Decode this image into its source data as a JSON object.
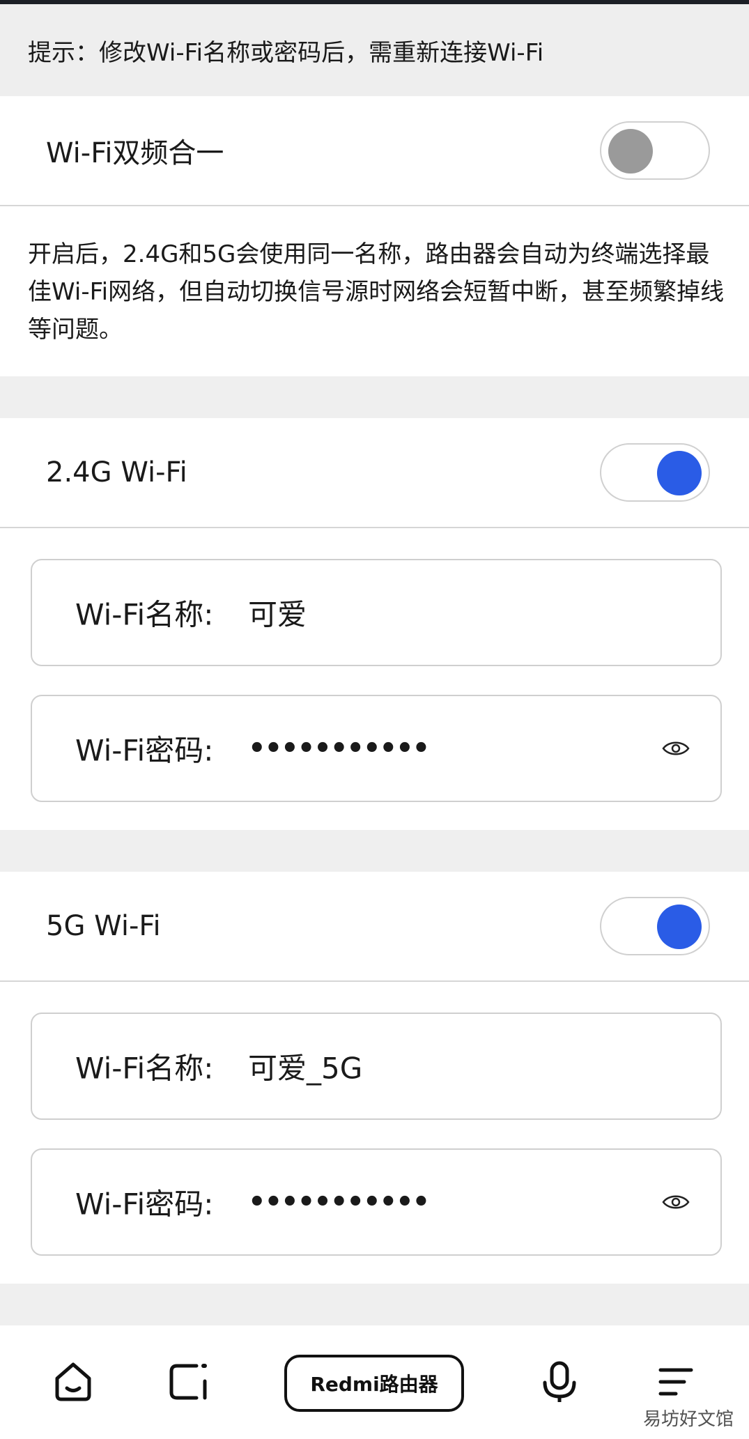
{
  "notice": "提示：修改Wi-Fi名称或密码后，需重新连接Wi-Fi",
  "dual_band": {
    "label": "Wi-Fi双频合一",
    "enabled": false,
    "description": "开启后，2.4G和5G会使用同一名称，路由器会自动为终端选择最佳Wi-Fi网络，但自动切换信号源时网络会短暂中断，甚至频繁掉线等问题。"
  },
  "band_24": {
    "label": "2.4G Wi-Fi",
    "enabled": true,
    "name_label": "Wi-Fi名称:",
    "name_value": "可爱",
    "password_label": "Wi-Fi密码:",
    "password_value": "•••••••••••",
    "show_password_icon": "eye-icon"
  },
  "band_5": {
    "label": "5G Wi-Fi",
    "enabled": true,
    "name_label": "Wi-Fi名称:",
    "name_value": "可爱_5G",
    "password_label": "Wi-Fi密码:",
    "password_value": "•••••••••••",
    "show_password_icon": "eye-icon"
  },
  "bottom_nav": {
    "home_icon": "home-icon",
    "devices_icon": "devices-icon",
    "brand_label": "Redmi路由器",
    "voice_icon": "microphone-icon",
    "menu_icon": "menu-icon"
  },
  "watermark": "易坊好文馆",
  "colors": {
    "accent": "#2a5ce6",
    "toggle_off": "#9a9a9a",
    "section_gap": "#efefef"
  }
}
